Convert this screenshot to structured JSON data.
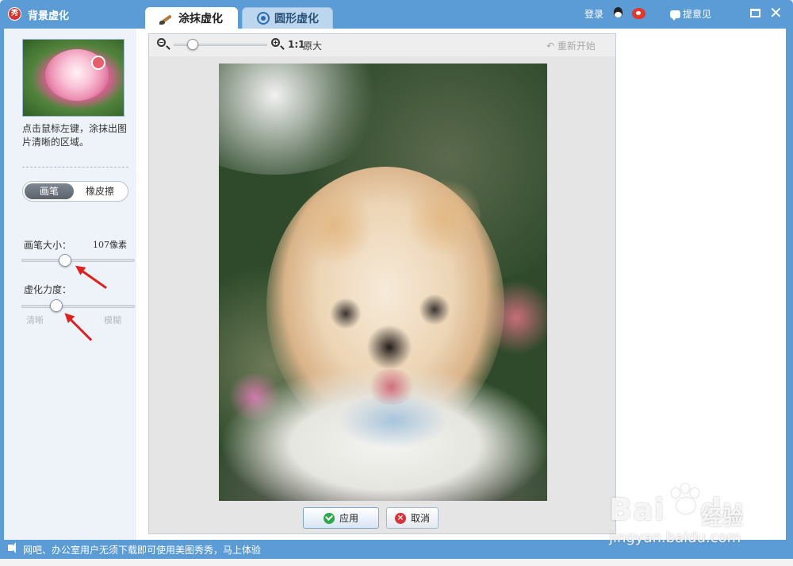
{
  "window": {
    "title": "背景虚化",
    "logo_glyph": "秀",
    "login_label": "登录",
    "feedback_label": "提意见",
    "close_glyph": "✕"
  },
  "tabs": [
    {
      "label": "涂抹虚化",
      "icon": "brush-icon",
      "active": true
    },
    {
      "label": "圆形虚化",
      "icon": "target-icon",
      "active": false
    }
  ],
  "left_panel": {
    "tip": "点击鼠标左键，涂抹出图片清晰的区域。",
    "mode_options": [
      "画笔",
      "橡皮擦"
    ],
    "selected_mode": "画笔",
    "brush_size_label": "画笔大小：",
    "brush_size_value": "107像素",
    "blur_label": "虚化力度：",
    "blur_min_label": "清晰",
    "blur_max_label": "模糊"
  },
  "toolbar": {
    "zoom_ratio": "1:1",
    "zoom_orig_label": "原大",
    "restart_label": "重新开始"
  },
  "actions": {
    "apply_label": "应用",
    "cancel_label": "取消"
  },
  "status_bar": {
    "text": "网吧、办公室用户无须下载即可使用美图秀秀，马上体验"
  },
  "watermark": {
    "logo": "Bai",
    "logo_suffix": "du",
    "cn": "经验",
    "url": "jingyan.baidu.com"
  },
  "colors": {
    "frame": "#5b9bd6",
    "accent_red": "#e02020"
  }
}
